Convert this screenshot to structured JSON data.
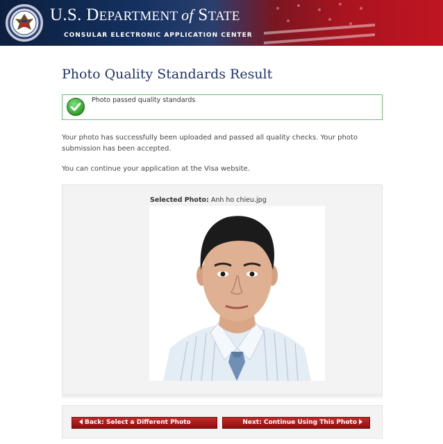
{
  "header": {
    "title_us": "U.S. D",
    "title_dept": "EPARTMENT ",
    "title_of": "of",
    "title_state": " S",
    "title_tate": "TATE",
    "subtitle": "CONSULAR ELECTRONIC APPLICATION CENTER"
  },
  "page": {
    "title": "Photo Quality Standards Result"
  },
  "notice": {
    "text": "Photo passed quality standards"
  },
  "body": {
    "paragraph1": "Your photo has successfully been uploaded and passed all quality checks. Your photo submission has been accepted.",
    "paragraph2": "You can continue your application at the Visa website."
  },
  "photo": {
    "label": "Selected Photo:",
    "filename": " Anh ho chieu.jpg"
  },
  "buttons": {
    "back": "Back: Select a Different Photo",
    "next": "Next: Continue Using This Photo"
  },
  "colors": {
    "title": "#1d3365",
    "button": "#a81414",
    "success_border": "#6fbe6f"
  }
}
